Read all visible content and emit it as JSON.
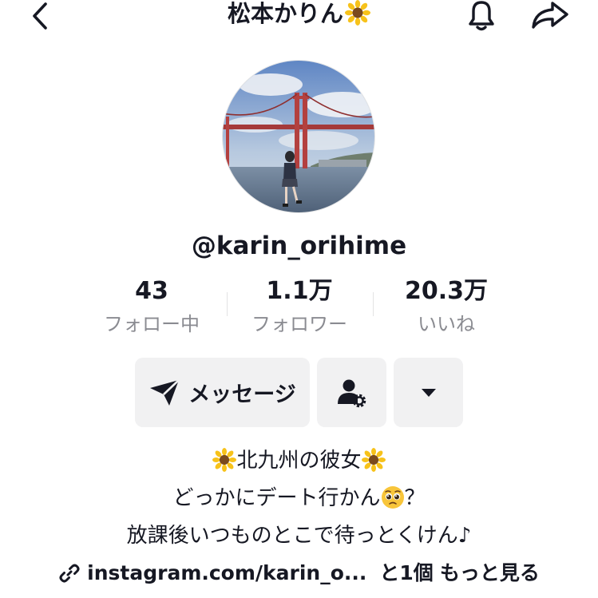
{
  "header": {
    "title": "松本かりん",
    "title_emoji": "🌻"
  },
  "profile": {
    "username": "@karin_orihime"
  },
  "stats": [
    {
      "value": "43",
      "label": "フォロー中"
    },
    {
      "value": "1.1万",
      "label": "フォロワー"
    },
    {
      "value": "20.3万",
      "label": "いいね"
    }
  ],
  "actions": {
    "message_label": "メッセージ"
  },
  "bio": {
    "line1": "北九州の彼女",
    "line2_a": "どっかにデート行かん",
    "line2_b": "？",
    "line3": "放課後いつものとこで待っとくけん♪"
  },
  "link": {
    "url": "instagram.com/karin_o...",
    "more_count": "と1個",
    "more_label": "もっと見る"
  },
  "colors": {
    "text": "#161823",
    "secondary": "#8a8b91",
    "button_bg": "#f1f1f2"
  }
}
